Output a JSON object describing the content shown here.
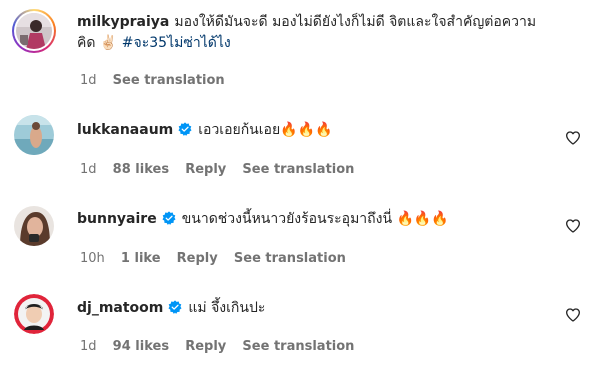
{
  "colors": {
    "text": "#262626",
    "secondary": "#737373",
    "hashtag": "#00376b",
    "verified": "#0095f6"
  },
  "post": {
    "username": "milkypraiya",
    "text_line1": "มองให้ดีมันจะดี มองไม่ดียังไงก็ไม่ดี จิตและใจสำคัญต่อความ",
    "text_line2": "คิด ✌🏻",
    "hashtag": "#จะ35ไม่ซ่าได้ไง",
    "time": "1d",
    "see_translation": "See translation",
    "avatar_icon": "story-ring-avatar"
  },
  "comments": [
    {
      "username": "lukkanaaum",
      "verified": true,
      "text": "เอวเอยก้นเอย🔥🔥🔥",
      "time": "1d",
      "likes": "88 likes",
      "reply": "Reply",
      "see_translation": "See translation"
    },
    {
      "username": "bunnyaire",
      "verified": true,
      "text": "ขนาดช่วงนี้หนาวยังร้อนระอุมาถึงนี่ 🔥🔥🔥",
      "time": "10h",
      "likes": "1 like",
      "reply": "Reply",
      "see_translation": "See translation"
    },
    {
      "username": "dj_matoom",
      "verified": true,
      "text": "แม่ จึ้งเกินปะ",
      "time": "1d",
      "likes": "94 likes",
      "reply": "Reply",
      "see_translation": "See translation"
    }
  ]
}
